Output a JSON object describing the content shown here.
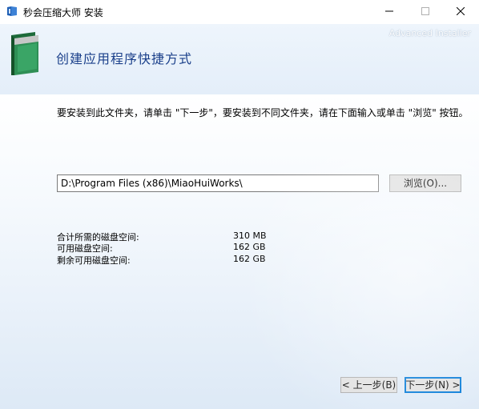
{
  "window": {
    "title": "秒会压缩大师 安装",
    "brand": "Advanced Installer"
  },
  "header": {
    "title": "创建应用程序快捷方式"
  },
  "body": {
    "instruction": "要安装到此文件夹，请单击 \"下一步\"，要安装到不同文件夹，请在下面输入或单击 \"浏览\" 按钮。",
    "path_value": "D:\\Program Files (x86)\\MiaoHuiWorks\\",
    "browse_label": "浏览(O)..."
  },
  "disk_space": [
    {
      "label": "合计所需的磁盘空间:",
      "value": "310 MB"
    },
    {
      "label": "可用磁盘空间:",
      "value": "162 GB"
    },
    {
      "label": "剩余可用磁盘空间:",
      "value": "162 GB"
    }
  ],
  "buttons": {
    "back": "< 上一步(B)",
    "next": "下一步(N) >"
  },
  "icons": {
    "app": "installer-app-icon",
    "header": "green-folder-icon",
    "minimize": "minimize-icon",
    "maximize": "maximize-icon",
    "close": "close-icon"
  }
}
